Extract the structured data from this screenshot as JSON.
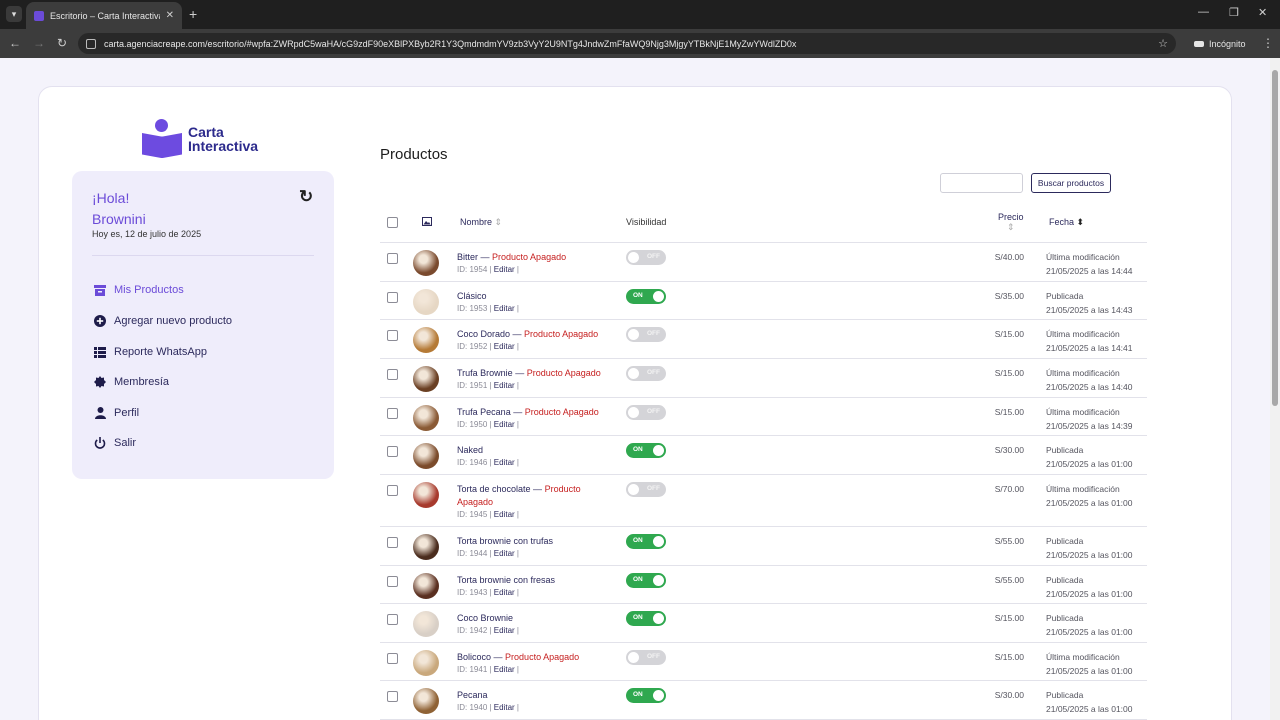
{
  "browser": {
    "tab_title": "Escritorio – Carta Interactiva",
    "url": "carta.agenciacreape.com/escritorio/#wpfa:ZWRpdC5waHA/cG9zdF90eXBlPXByb2R1Y3QmdmdmYV9zb3VyY2U9NTg4JndwZmFfaWQ9Njg3MjgyYTBkNjE1MyZwYWdlZD0x",
    "incognito_label": "Incógnito"
  },
  "logo": {
    "line1": "Carta",
    "line2": "Interactiva"
  },
  "sidebar": {
    "greeting": "¡Hola!",
    "user": "Brownini",
    "date": "Hoy es, 12 de julio de 2025",
    "items": [
      {
        "label": "Mis Productos",
        "icon": "archive-icon"
      },
      {
        "label": "Agregar nuevo producto",
        "icon": "plus-circle-icon"
      },
      {
        "label": "Reporte WhatsApp",
        "icon": "table-icon"
      },
      {
        "label": "Membresía",
        "icon": "badge-icon"
      },
      {
        "label": "Perfil",
        "icon": "user-icon"
      },
      {
        "label": "Salir",
        "icon": "power-icon"
      }
    ]
  },
  "main": {
    "title": "Productos",
    "search_button": "Buscar productos",
    "columns": {
      "name": "Nombre",
      "visibility": "Visibilidad",
      "price": "Precio",
      "date": "Fecha"
    },
    "id_prefix": "ID:",
    "edit_label": "Editar",
    "off_suffix": "Producto Apagado",
    "products": [
      {
        "name": "Bitter",
        "apagado": true,
        "id": "1954",
        "visible": false,
        "price": "S/40.00",
        "status": "Última modificación",
        "date": "21/05/2025 a las 14:44"
      },
      {
        "name": "Clásico",
        "apagado": false,
        "id": "1953",
        "visible": true,
        "price": "S/35.00",
        "status": "Publicada",
        "date": "21/05/2025 a las 14:43"
      },
      {
        "name": "Coco Dorado",
        "apagado": true,
        "id": "1952",
        "visible": false,
        "price": "S/15.00",
        "status": "Última modificación",
        "date": "21/05/2025 a las 14:41"
      },
      {
        "name": "Trufa Brownie",
        "apagado": true,
        "id": "1951",
        "visible": false,
        "price": "S/15.00",
        "status": "Última modificación",
        "date": "21/05/2025 a las 14:40"
      },
      {
        "name": "Trufa Pecana",
        "apagado": true,
        "id": "1950",
        "visible": false,
        "price": "S/15.00",
        "status": "Última modificación",
        "date": "21/05/2025 a las 14:39"
      },
      {
        "name": "Naked",
        "apagado": false,
        "id": "1946",
        "visible": true,
        "price": "S/30.00",
        "status": "Publicada",
        "date": "21/05/2025 a las 01:00"
      },
      {
        "name": "Torta de chocolate",
        "apagado": true,
        "id": "1945",
        "visible": false,
        "price": "S/70.00",
        "status": "Última modificación",
        "date": "21/05/2025 a las 01:00"
      },
      {
        "name": "Torta brownie con trufas",
        "apagado": false,
        "id": "1944",
        "visible": true,
        "price": "S/55.00",
        "status": "Publicada",
        "date": "21/05/2025 a las 01:00"
      },
      {
        "name": "Torta brownie con fresas",
        "apagado": false,
        "id": "1943",
        "visible": true,
        "price": "S/55.00",
        "status": "Publicada",
        "date": "21/05/2025 a las 01:00"
      },
      {
        "name": "Coco Brownie",
        "apagado": false,
        "id": "1942",
        "visible": true,
        "price": "S/15.00",
        "status": "Publicada",
        "date": "21/05/2025 a las 01:00"
      },
      {
        "name": "Bolicoco",
        "apagado": true,
        "id": "1941",
        "visible": false,
        "price": "S/15.00",
        "status": "Última modificación",
        "date": "21/05/2025 a las 01:00"
      },
      {
        "name": "Pecana",
        "apagado": false,
        "id": "1940",
        "visible": true,
        "price": "S/30.00",
        "status": "Publicada",
        "date": "21/05/2025 a las 01:00"
      }
    ]
  },
  "toggle_labels": {
    "on": "ON",
    "off": "OFF"
  },
  "colors": {
    "accent": "#6b4bd8",
    "brand_dark": "#2c2a8c",
    "on": "#2fa84f",
    "off_text": "#c62020"
  }
}
